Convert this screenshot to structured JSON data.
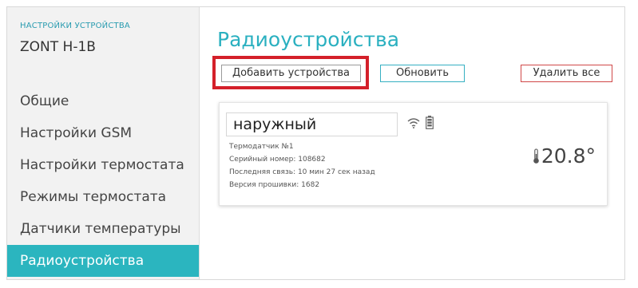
{
  "sidebar": {
    "device_label": "НАСТРОЙКИ УСТРОЙСТВА",
    "device_name": "ZONT H-1B",
    "items": [
      {
        "label": "Общие"
      },
      {
        "label": "Настройки GSM"
      },
      {
        "label": "Настройки термостата"
      },
      {
        "label": "Режимы термостата"
      },
      {
        "label": "Датчики температуры"
      },
      {
        "label": "Радиоустройства"
      }
    ],
    "active_item": "Радиоустройства"
  },
  "main": {
    "title": "Радиоустройства",
    "buttons": {
      "add": "Добавить устройства",
      "refresh": "Обновить",
      "delete_all": "Удалить все"
    },
    "device": {
      "name": "наружный",
      "type": "Термодатчик №1",
      "serial": "Серийный номер: 108682",
      "last_seen": "Последняя связь: 10 мин 27 сек назад",
      "firmware": "Версия прошивки: 1682",
      "temperature": "20.8°",
      "icons": [
        "signal-icon",
        "battery-icon",
        "thermometer-icon"
      ]
    }
  },
  "colors": {
    "accent": "#2bb5bf",
    "highlight": "#d4202a",
    "delete": "#d04848"
  }
}
